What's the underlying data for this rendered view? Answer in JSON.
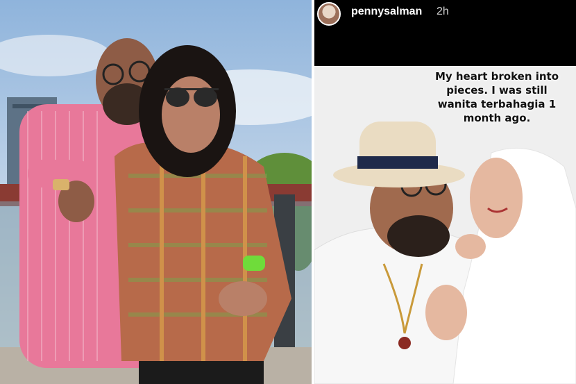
{
  "story": {
    "username": "pennysalman",
    "time": "2h",
    "caption": "My heart broken into pieces. I was still wanita terbahagia 1 month ago."
  },
  "icons": {
    "avatar": "profile-avatar"
  }
}
